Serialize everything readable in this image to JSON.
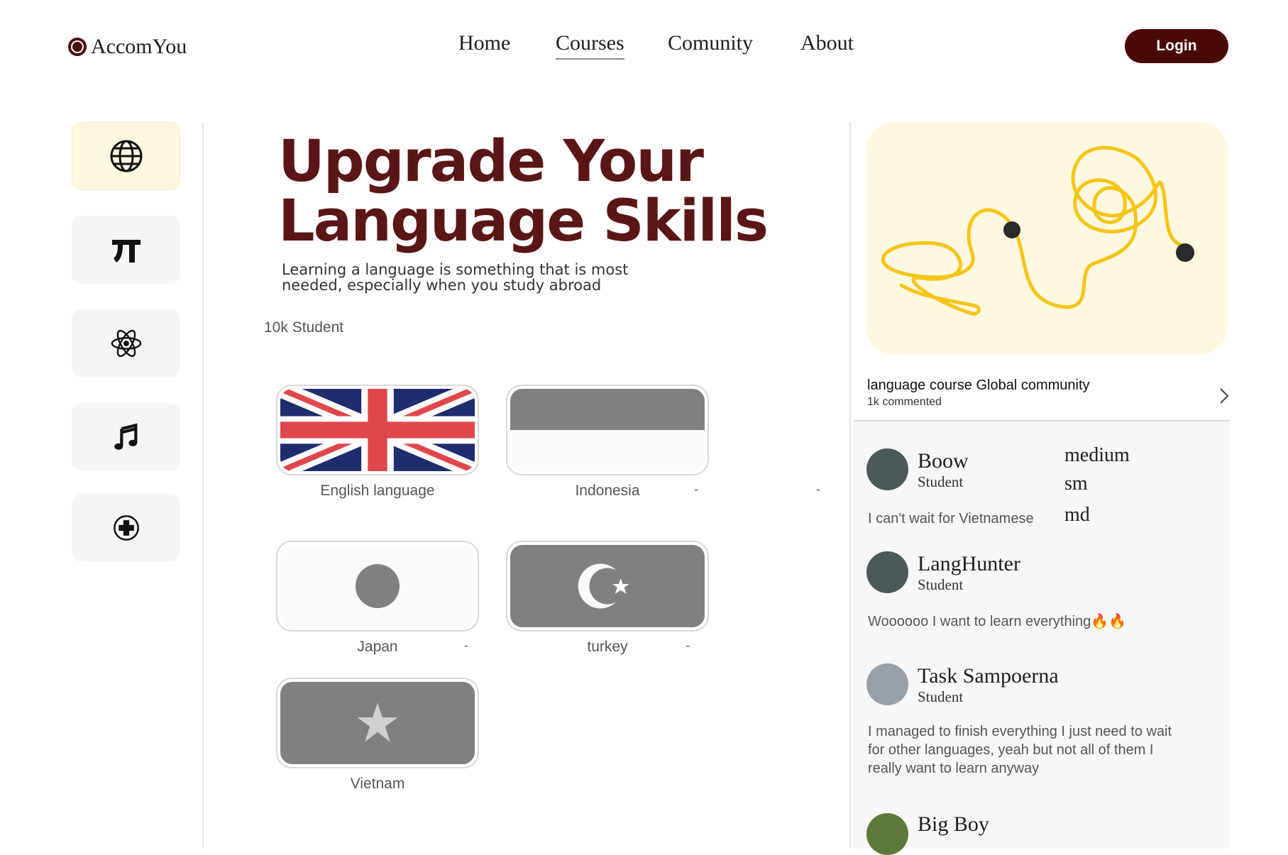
{
  "header": {
    "logo_text": "AccomYou",
    "nav": [
      "Home",
      "Courses",
      "Comunity",
      "About"
    ],
    "active_nav": "Courses",
    "login_label": "Login"
  },
  "rail": {
    "items": [
      {
        "icon": "globe-icon",
        "active": true
      },
      {
        "icon": "pi-icon",
        "active": false
      },
      {
        "icon": "atom-icon",
        "active": false
      },
      {
        "icon": "music-note-icon",
        "active": false
      },
      {
        "icon": "medical-cross-icon",
        "active": false
      }
    ]
  },
  "hero": {
    "title_line1": "Upgrade Your",
    "title_line2": "Language Skills",
    "subtitle_line1": "Learning a language is something that is most",
    "subtitle_line2": "needed, especially when you study abroad",
    "students": "10k Student"
  },
  "languages": [
    {
      "label": "English language",
      "flag": "uk-flag",
      "dash": ""
    },
    {
      "label": "Indonesia",
      "flag": "indonesia-flag",
      "dash": "-"
    },
    {
      "label": "Japan",
      "flag": "japan-flag",
      "dash": "-"
    },
    {
      "label": "turkey",
      "flag": "turkey-flag",
      "dash": "-"
    },
    {
      "label": "Vietnam",
      "flag": "vietnam-flag",
      "dash": ""
    }
  ],
  "stray_dash": "-",
  "community": {
    "title": "language course Global  community",
    "commented": "1k commented",
    "size_tags": [
      "medium",
      "sm",
      "md"
    ],
    "comments": [
      {
        "name": "Boow",
        "role": "Student",
        "text": "I can't wait for Vietnamese",
        "avatar_color": "#4a5a58"
      },
      {
        "name": "LangHunter",
        "role": "Student",
        "text": "Woooooo I want to learn everything🔥🔥",
        "avatar_color": "#4a5a58"
      },
      {
        "name": "Task Sampoerna",
        "role": "Student",
        "text_lines": [
          "I managed to finish everything I just need to wait",
          "for other languages, yeah but not all of them I",
          "really want to learn anyway"
        ],
        "avatar_color": "#9aa0a8"
      },
      {
        "name": "Big Boy",
        "role": "",
        "text": "",
        "avatar_color": "#5b7a3a"
      }
    ]
  },
  "colors": {
    "brand": "#4a0909",
    "title": "#5a1616",
    "cream": "#fef8e1",
    "squiggle": "#f5c518"
  }
}
